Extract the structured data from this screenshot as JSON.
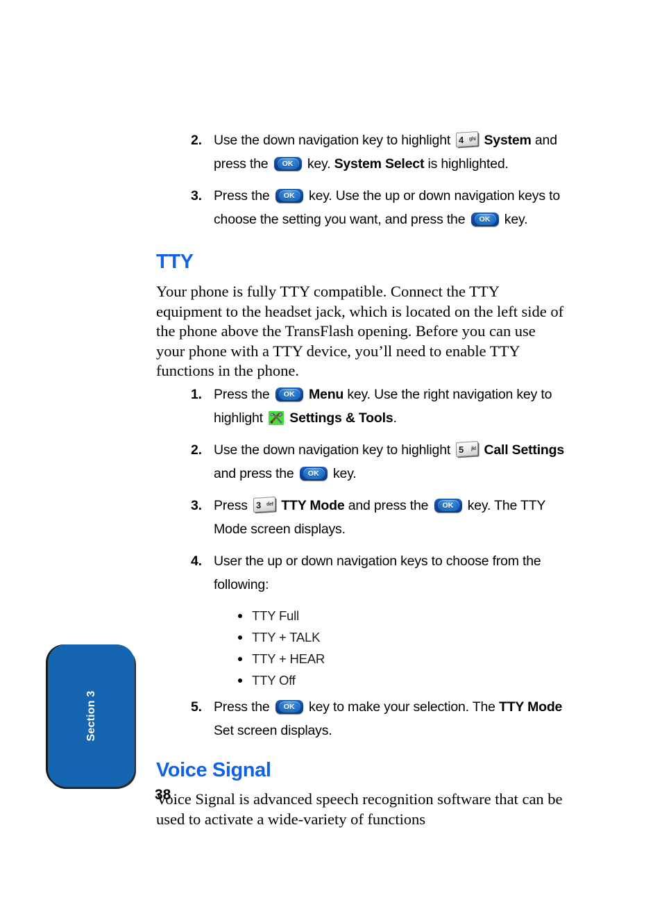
{
  "page": {
    "number": "38",
    "section_tab": "Section 3",
    "accent_color": "#0f62e8",
    "tab_color": "#1565b0"
  },
  "icons": {
    "ok_key": {
      "name": "ok-key-icon",
      "label": "OK"
    },
    "key_3": {
      "name": "phone-key-3-icon",
      "digit": "3",
      "sub": "def"
    },
    "key_4": {
      "name": "phone-key-4-icon",
      "digit": "4",
      "sub": "ghi"
    },
    "key_5": {
      "name": "phone-key-5-icon",
      "digit": "5",
      "sub": "jkl"
    },
    "settings_tools": {
      "name": "settings-and-tools-icon"
    }
  },
  "top_steps": [
    {
      "num": "2.",
      "parts": [
        {
          "t": "text",
          "v": "Use the down navigation key to highlight "
        },
        {
          "t": "numkey",
          "v": "key_4"
        },
        {
          "t": "bold",
          "v": " System"
        },
        {
          "t": "text",
          "v": " and press the "
        },
        {
          "t": "okkey",
          "v": "ok_key"
        },
        {
          "t": "text",
          "v": " key. "
        },
        {
          "t": "bold",
          "v": "System Select"
        },
        {
          "t": "text",
          "v": " is highlighted."
        }
      ]
    },
    {
      "num": "3.",
      "parts": [
        {
          "t": "text",
          "v": "Press the "
        },
        {
          "t": "okkey",
          "v": "ok_key"
        },
        {
          "t": "text",
          "v": " key. Use the up or down navigation keys to choose the setting you want, and press the "
        },
        {
          "t": "okkey",
          "v": "ok_key"
        },
        {
          "t": "text",
          "v": " key."
        }
      ]
    }
  ],
  "tty": {
    "heading": "TTY",
    "intro": "Your phone is fully TTY compatible. Connect the TTY equipment to the headset jack, which is located on the left side of the phone above the TransFlash opening. Before you can use your phone with a TTY device, you’ll need to enable TTY functions in the phone.",
    "steps": [
      {
        "num": "1.",
        "parts": [
          {
            "t": "text",
            "v": "Press the "
          },
          {
            "t": "okkey",
            "v": "ok_key"
          },
          {
            "t": "bold",
            "v": " Menu"
          },
          {
            "t": "text",
            "v": " key. Use the right navigation key to highlight "
          },
          {
            "t": "toolsicon",
            "v": "settings_tools"
          },
          {
            "t": "bold",
            "v": " Settings & Tools"
          },
          {
            "t": "text",
            "v": "."
          }
        ]
      },
      {
        "num": "2.",
        "parts": [
          {
            "t": "text",
            "v": "Use the down navigation key to highlight "
          },
          {
            "t": "numkey",
            "v": "key_5"
          },
          {
            "t": "bold",
            "v": " Call Settings"
          },
          {
            "t": "text",
            "v": " and press the "
          },
          {
            "t": "okkey",
            "v": "ok_key"
          },
          {
            "t": "text",
            "v": " key."
          }
        ]
      },
      {
        "num": "3.",
        "parts": [
          {
            "t": "text",
            "v": "Press "
          },
          {
            "t": "numkey",
            "v": "key_3"
          },
          {
            "t": "bold",
            "v": " TTY Mode"
          },
          {
            "t": "text",
            "v": " and press the "
          },
          {
            "t": "okkey",
            "v": "ok_key"
          },
          {
            "t": "text",
            "v": " key. The TTY Mode screen displays."
          }
        ]
      },
      {
        "num": "4.",
        "parts": [
          {
            "t": "text",
            "v": "User the up or down navigation keys to choose from the following:"
          }
        ]
      }
    ],
    "options": [
      "TTY Full",
      "TTY + TALK",
      "TTY + HEAR",
      "TTY Off"
    ],
    "final_step": {
      "num": "5.",
      "parts": [
        {
          "t": "text",
          "v": "Press the "
        },
        {
          "t": "okkey",
          "v": "ok_key"
        },
        {
          "t": "text",
          "v": " key to make your selection. The "
        },
        {
          "t": "bold",
          "v": "TTY Mode"
        },
        {
          "t": "text",
          "v": " Set screen displays."
        }
      ]
    }
  },
  "voice_signal": {
    "heading": "Voice Signal",
    "intro": "Voice Signal is advanced speech recognition software that can be used to activate a wide-variety of functions"
  }
}
